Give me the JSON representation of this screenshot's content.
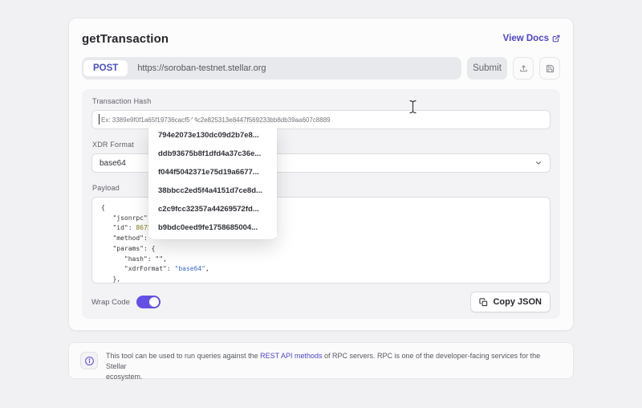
{
  "endpoint": {
    "title": "getTransaction",
    "view_docs_label": "View Docs"
  },
  "request": {
    "method": "POST",
    "url": "https://soroban-testnet.stellar.org",
    "submit_label": "Submit"
  },
  "form": {
    "tx_hash": {
      "label": "Transaction Hash",
      "value": "",
      "placeholder": "Ex: 3389e9f0f1a65f19736cacf544c2e825313e8447f569233bb8db39aa607c8889"
    },
    "xdr_format": {
      "label": "XDR Format",
      "selected_value": "base64"
    },
    "payload": {
      "label": "Payload",
      "lines": [
        {
          "indent": 0,
          "parts": [
            {
              "t": "{",
              "c": "plain"
            }
          ]
        },
        {
          "indent": 3,
          "parts": [
            {
              "t": "\"jsonrpc\": ",
              "c": "plain"
            }
          ]
        },
        {
          "indent": 3,
          "parts": [
            {
              "t": "\"id\": ",
              "c": "plain"
            },
            {
              "t": "86753",
              "c": "num"
            }
          ]
        },
        {
          "indent": 3,
          "parts": [
            {
              "t": "\"method\": \"",
              "c": "plain"
            }
          ]
        },
        {
          "indent": 3,
          "parts": [
            {
              "t": "\"params\": {",
              "c": "plain"
            }
          ]
        },
        {
          "indent": 6,
          "parts": [
            {
              "t": "\"hash\": \"\",",
              "c": "plain"
            }
          ]
        },
        {
          "indent": 6,
          "parts": [
            {
              "t": "\"xdrFormat\": ",
              "c": "plain"
            },
            {
              "t": "\"base64\"",
              "c": "str"
            },
            {
              "t": ",",
              "c": "plain"
            }
          ]
        },
        {
          "indent": 3,
          "parts": [
            {
              "t": "},",
              "c": "plain"
            }
          ]
        },
        {
          "indent": 0,
          "parts": [
            {
              "t": "}",
              "c": "plain"
            }
          ]
        }
      ]
    },
    "wrap_code": {
      "label": "Wrap Code",
      "enabled": true
    },
    "copy_button_label": "Copy JSON"
  },
  "hash_dropdown": {
    "items": [
      "794e2073e130dc09d2b7e8...",
      "ddb93675b8f1dfd4a37c36e...",
      "f044f5042371e75d19a6677...",
      "38bbcc2ed5f4a4151d7ce8d...",
      "c2c9fcc32357a44269572fd...",
      "b9bdc0eed9fe1758685004..."
    ]
  },
  "info_note": {
    "before_link": "This tool can be used to run queries against the ",
    "link": "REST API methods",
    "after_link": " of RPC servers. RPC is one of the developer-facing services for the Stellar",
    "line2": "ecosystem."
  },
  "colors": {
    "accent_purple": "#6550e6",
    "link_indigo": "#4d44c6",
    "post_blue": "#4750bd",
    "code_number": "#857a1e",
    "code_string": "#3d68c9"
  }
}
